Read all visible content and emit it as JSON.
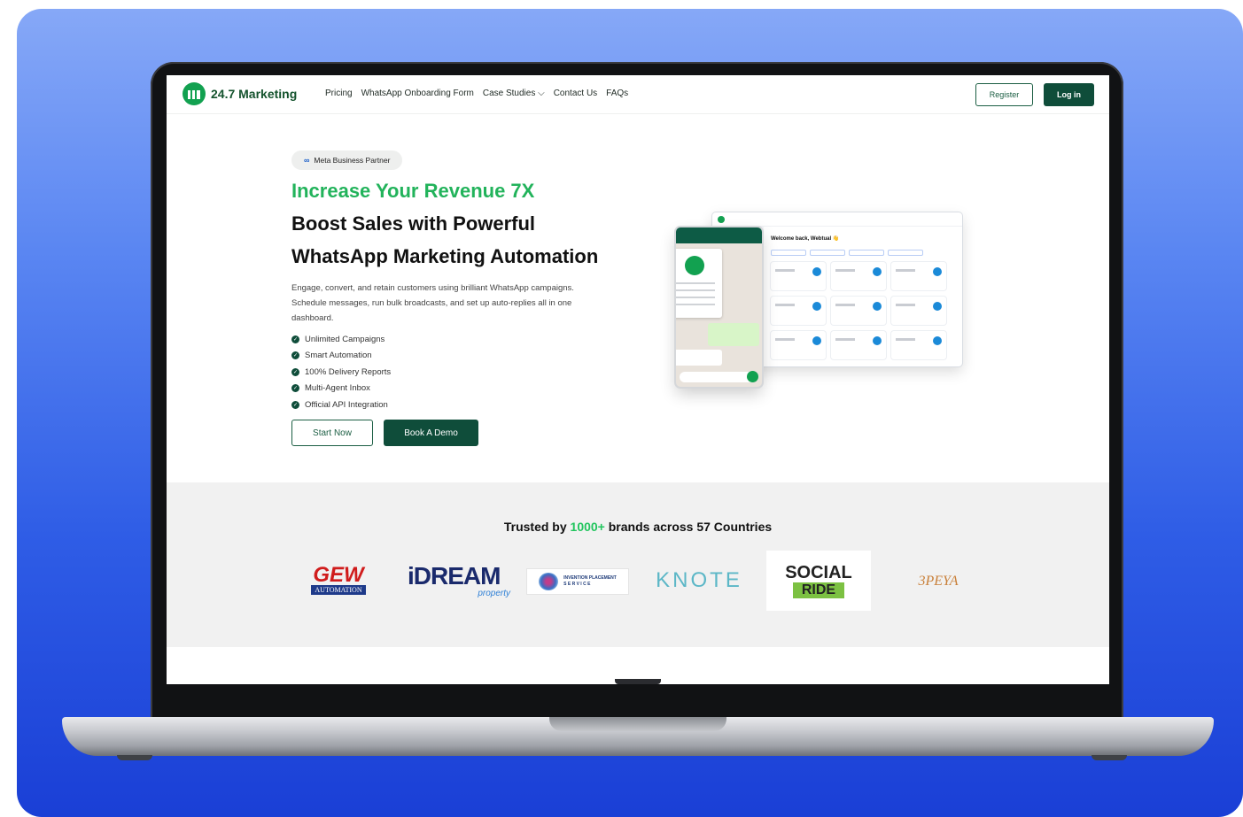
{
  "nav": {
    "brand": "24.7 Marketing",
    "links": [
      "Pricing",
      "WhatsApp Onboarding Form",
      "Case Studies ⌵",
      "Contact Us",
      "FAQs"
    ],
    "register_label": "Register",
    "login_label": "Log in"
  },
  "hero": {
    "badge": "Meta Business Partner",
    "headline_accent": "Increase Your Revenue 7X",
    "headline_line2": "Boost Sales with Powerful",
    "headline_line3": "WhatsApp Marketing Automation",
    "description": "Engage, convert, and retain customers using brilliant WhatsApp campaigns. Schedule messages, run bulk broadcasts, and set up auto-replies all in one dashboard.",
    "features": [
      "Unlimited Campaigns",
      "Smart Automation",
      "100% Delivery Reports",
      "Multi-Agent Inbox",
      "Official API Integration"
    ],
    "start_label": "Start Now",
    "demo_label": "Book A Demo"
  },
  "mockup": {
    "welcome": "Welcome back, Webtual 👋"
  },
  "trusted": {
    "prefix": "Trusted by ",
    "accent": "1000+",
    "suffix": " brands across 57 Countries"
  },
  "brands": {
    "gew_top": "GEW",
    "gew_bottom": "AUTOMATION",
    "idream_top": "iDREAM",
    "idream_bottom": "property",
    "invention": "INVENTION PLACEMENT",
    "invention_sub": "S E R V I C E",
    "knote": "KNOTE",
    "social_top": "SOCIAL",
    "social_bottom": "RIDE",
    "peya": "3PEYA"
  },
  "colors": {
    "brand_green": "#22b35b",
    "dark_green": "#0f4d3a",
    "background_blue": "#2f5de6"
  }
}
